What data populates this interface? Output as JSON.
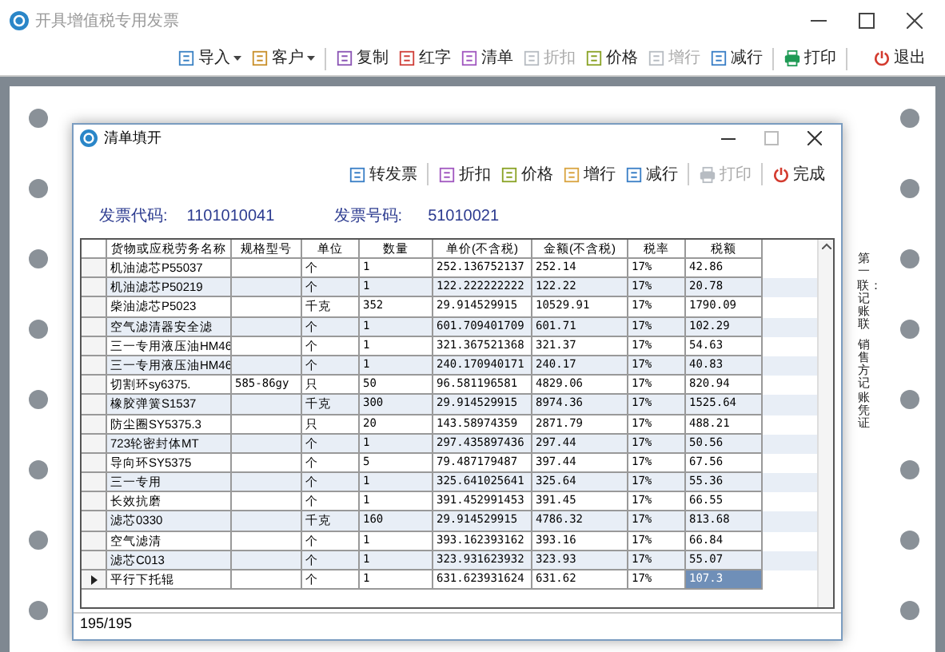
{
  "window": {
    "title": "开具增值税专用发票"
  },
  "toolbar": [
    {
      "label": "导入",
      "kind": "dropdown",
      "disabled": false
    },
    {
      "label": "客户",
      "kind": "dropdown",
      "disabled": false
    },
    {
      "label": "复制",
      "kind": "button",
      "disabled": false
    },
    {
      "label": "红字",
      "kind": "button",
      "disabled": false
    },
    {
      "label": "清单",
      "kind": "button",
      "disabled": false
    },
    {
      "label": "折扣",
      "kind": "button",
      "disabled": true
    },
    {
      "label": "价格",
      "kind": "button",
      "disabled": false
    },
    {
      "label": "增行",
      "kind": "button",
      "disabled": true
    },
    {
      "label": "减行",
      "kind": "button",
      "disabled": false
    },
    {
      "label": "打印",
      "kind": "button",
      "disabled": false
    },
    {
      "label": "退出",
      "kind": "button",
      "disabled": false
    }
  ],
  "invoice": {
    "side_notes": [
      "第一联：记账联",
      "销售方记账凭证"
    ]
  },
  "dialog": {
    "title": "清单填开",
    "toolbar": [
      {
        "label": "转发票",
        "disabled": false
      },
      {
        "label": "折扣",
        "disabled": false
      },
      {
        "label": "价格",
        "disabled": false
      },
      {
        "label": "增行",
        "disabled": false
      },
      {
        "label": "减行",
        "disabled": false
      },
      {
        "label": "打印",
        "disabled": true
      },
      {
        "label": "完成",
        "disabled": false
      }
    ],
    "code_label": "发票代码:",
    "code": "1101010041",
    "number_label": "发票号码:",
    "number": "51010021",
    "table": {
      "columns": [
        "货物或应税劳务名称",
        "规格型号",
        "单位",
        "数量",
        "单价(不含税)",
        "金额(不含税)",
        "税率",
        "税额"
      ],
      "rows": [
        {
          "cells": [
            "机油滤芯P55037",
            "",
            "个",
            "1",
            "252.136752137",
            "252.14",
            "17%",
            "42.86"
          ],
          "selected": false
        },
        {
          "cells": [
            "机油滤芯P50219",
            "",
            "个",
            "1",
            "122.222222222",
            "122.22",
            "17%",
            "20.78"
          ],
          "selected": false
        },
        {
          "cells": [
            "柴油滤芯P5023",
            "",
            "千克",
            "352",
            "29.914529915",
            "10529.91",
            "17%",
            "1790.09"
          ],
          "selected": false
        },
        {
          "cells": [
            "空气滤清器安全滤",
            "",
            "个",
            "1",
            "601.709401709",
            "601.71",
            "17%",
            "102.29"
          ],
          "selected": false
        },
        {
          "cells": [
            "三一专用液压油HM46",
            "",
            "个",
            "1",
            "321.367521368",
            "321.37",
            "17%",
            "54.63"
          ],
          "selected": false
        },
        {
          "cells": [
            "三一专用液压油HM46",
            "",
            "个",
            "1",
            "240.170940171",
            "240.17",
            "17%",
            "40.83"
          ],
          "selected": false
        },
        {
          "cells": [
            "切割环sy6375.",
            "585-86gy",
            "只",
            "50",
            "96.581196581",
            "4829.06",
            "17%",
            "820.94"
          ],
          "selected": false
        },
        {
          "cells": [
            "橡胶弹簧S1537",
            "",
            "千克",
            "300",
            "29.914529915",
            "8974.36",
            "17%",
            "1525.64"
          ],
          "selected": false
        },
        {
          "cells": [
            "防尘圈SY5375.3",
            "",
            "只",
            "20",
            "143.58974359",
            "2871.79",
            "17%",
            "488.21"
          ],
          "selected": false
        },
        {
          "cells": [
            "723轮密封体MT",
            "",
            "个",
            "1",
            "297.435897436",
            "297.44",
            "17%",
            "50.56"
          ],
          "selected": false
        },
        {
          "cells": [
            "导向环SY5375",
            "",
            "个",
            "5",
            "79.487179487",
            "397.44",
            "17%",
            "67.56"
          ],
          "selected": false
        },
        {
          "cells": [
            "三一专用",
            "",
            "个",
            "1",
            "325.641025641",
            "325.64",
            "17%",
            "55.36"
          ],
          "selected": false
        },
        {
          "cells": [
            "长效抗磨",
            "",
            "个",
            "1",
            "391.452991453",
            "391.45",
            "17%",
            "66.55"
          ],
          "selected": false
        },
        {
          "cells": [
            "滤芯0330",
            "",
            "千克",
            "160",
            "29.914529915",
            "4786.32",
            "17%",
            "813.68"
          ],
          "selected": false
        },
        {
          "cells": [
            "空气滤清",
            "",
            "个",
            "1",
            "393.162393162",
            "393.16",
            "17%",
            "66.84"
          ],
          "selected": false
        },
        {
          "cells": [
            "滤芯C013",
            "",
            "个",
            "1",
            "323.931623932",
            "323.93",
            "17%",
            "55.07"
          ],
          "selected": false
        },
        {
          "cells": [
            "平行下托辊",
            "",
            "个",
            "1",
            "631.623931624",
            "631.62",
            "17%",
            "107.3"
          ],
          "selected": true
        }
      ]
    },
    "status": "195/195"
  }
}
